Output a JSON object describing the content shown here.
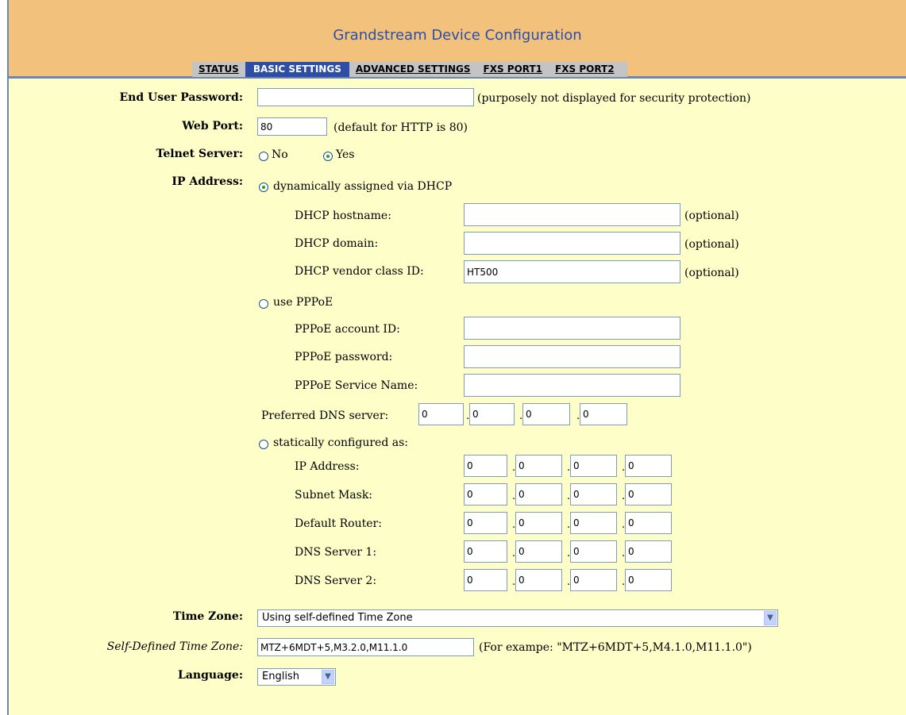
{
  "header": {
    "title": "Grandstream Device Configuration",
    "tabs": [
      "STATUS",
      "BASIC SETTINGS",
      "ADVANCED SETTINGS",
      "FXS PORT1",
      "FXS PORT2"
    ]
  },
  "form": {
    "end_user_password": {
      "label": "End User Password:",
      "value": "",
      "note": "(purposely not displayed for security protection)"
    },
    "web_port": {
      "label": "Web Port:",
      "value": "80",
      "note": "(default for HTTP is 80)"
    },
    "telnet_server": {
      "label": "Telnet Server:",
      "options": [
        "No",
        "Yes"
      ],
      "selected": "Yes"
    },
    "ip_address": {
      "label": "IP Address:",
      "dhcp": {
        "label": "dynamically assigned via DHCP",
        "hostname": {
          "label": "DHCP hostname:",
          "value": "",
          "note": "(optional)"
        },
        "domain": {
          "label": "DHCP domain:",
          "value": "",
          "note": "(optional)"
        },
        "vendor_class": {
          "label": "DHCP vendor class ID:",
          "value": "HT500",
          "note": "(optional)"
        }
      },
      "pppoe": {
        "label": "use PPPoE",
        "account_id": {
          "label": "PPPoE account ID:",
          "value": ""
        },
        "password": {
          "label": "PPPoE password:",
          "value": ""
        },
        "service_name": {
          "label": "PPPoE Service Name:",
          "value": ""
        }
      },
      "preferred_dns": {
        "label": "Preferred DNS server:",
        "octets": [
          "0",
          "0",
          "0",
          "0"
        ]
      },
      "static": {
        "label": "statically configured as:",
        "ip_address": {
          "label": "IP Address:",
          "octets": [
            "0",
            "0",
            "0",
            "0"
          ]
        },
        "subnet_mask": {
          "label": "Subnet Mask:",
          "octets": [
            "0",
            "0",
            "0",
            "0"
          ]
        },
        "default_router": {
          "label": "Default Router:",
          "octets": [
            "0",
            "0",
            "0",
            "0"
          ]
        },
        "dns_server_1": {
          "label": "DNS Server 1:",
          "octets": [
            "0",
            "0",
            "0",
            "0"
          ]
        },
        "dns_server_2": {
          "label": "DNS Server 2:",
          "octets": [
            "0",
            "0",
            "0",
            "0"
          ]
        }
      },
      "selected": "dhcp"
    },
    "time_zone": {
      "label": "Time Zone:",
      "value": "Using self-defined Time Zone"
    },
    "self_defined_time_zone": {
      "label": "Self-Defined Time Zone:",
      "value": "MTZ+6MDT+5,M3.2.0,M11.1.0",
      "note": "(For exampe: \"MTZ+6MDT+5,M4.1.0,M11.1.0\")"
    },
    "language": {
      "label": "Language:",
      "value": "English"
    }
  },
  "colors": {
    "header_bg": "#f2c27c",
    "content_bg": "#fefec9",
    "title_color": "#2e4ea6",
    "active_tab_bg": "#2e4ea6",
    "tab_bar_bg": "#c4c4c4"
  }
}
